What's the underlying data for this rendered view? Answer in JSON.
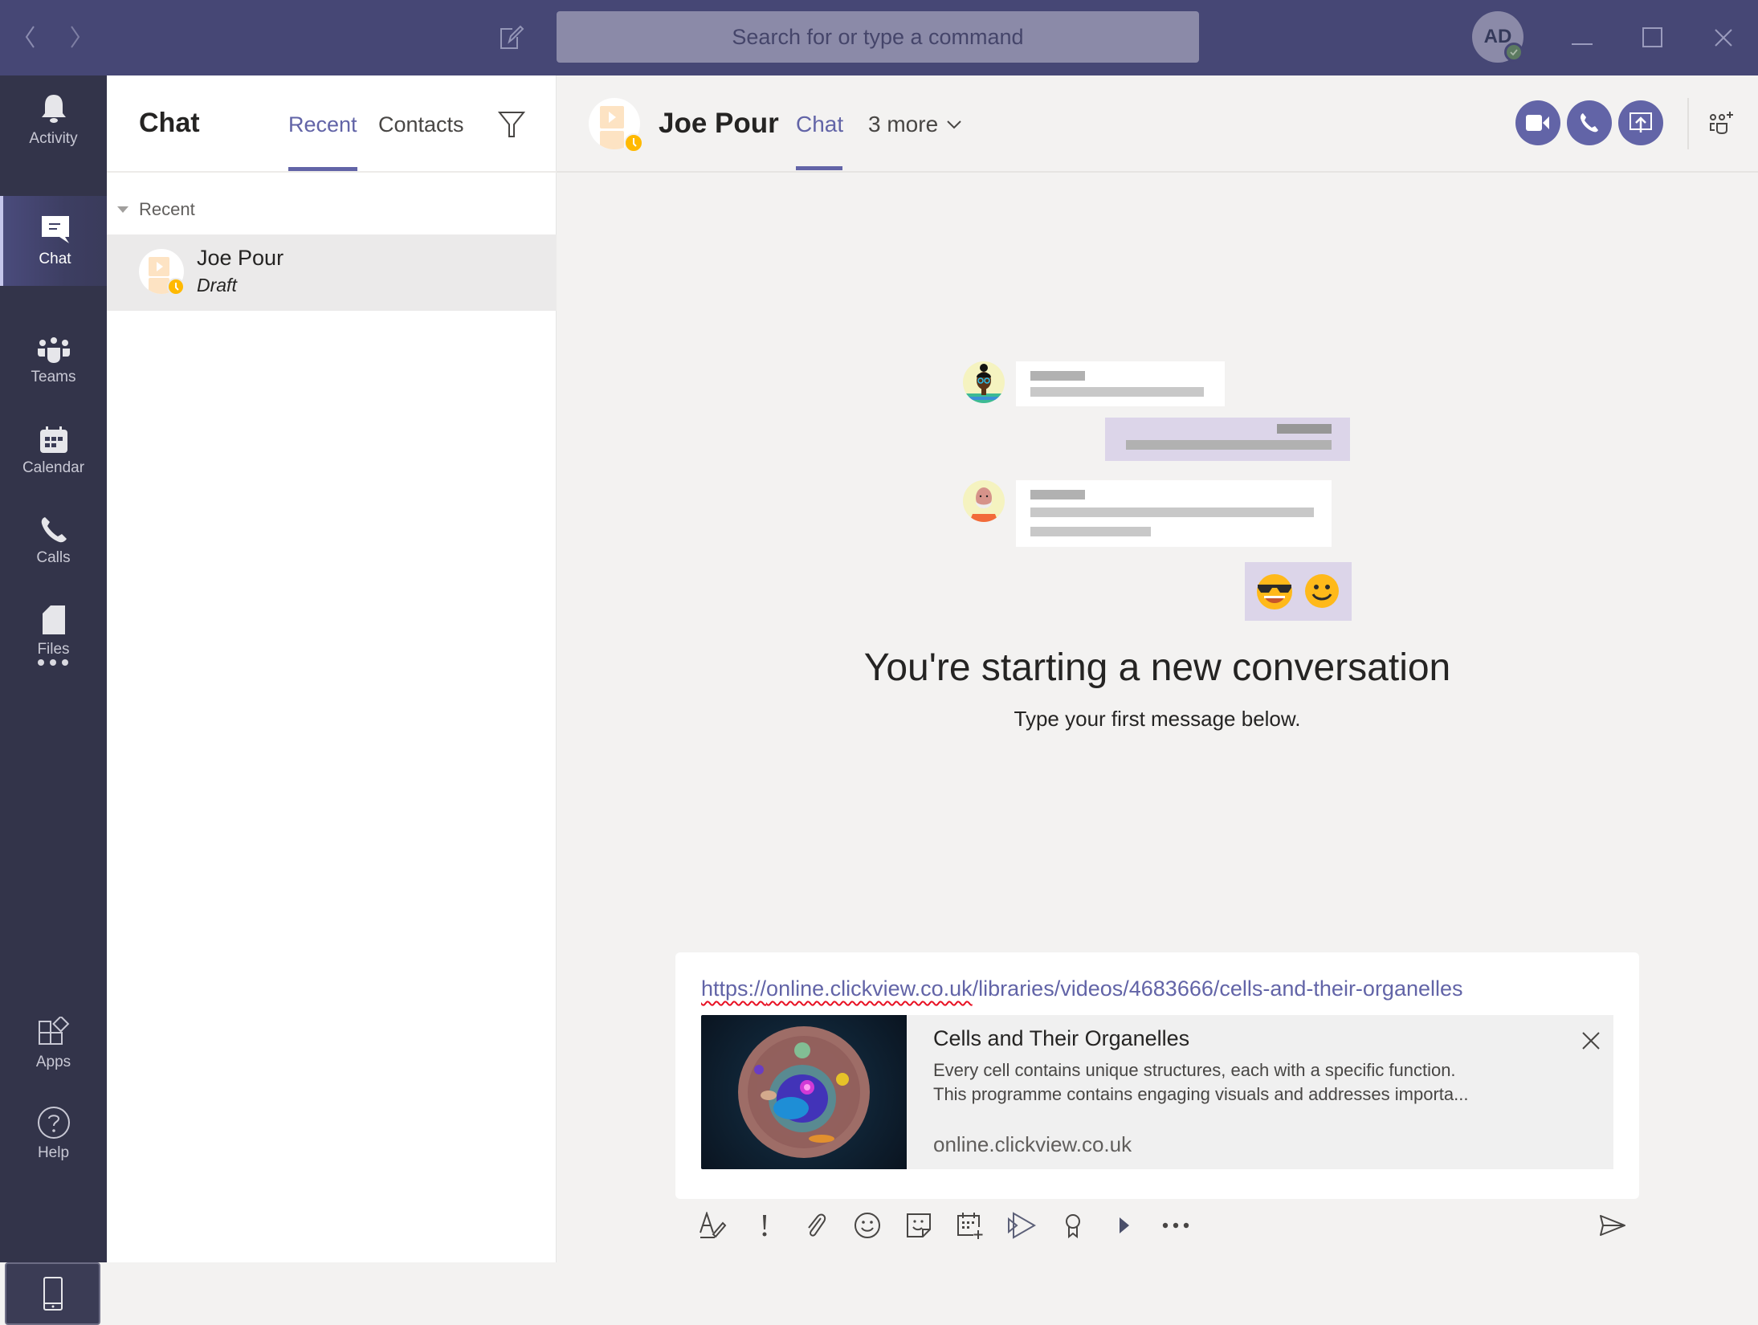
{
  "titlebar": {
    "search_placeholder": "Search for or type a command",
    "user_initials": "AD",
    "icons": {
      "back": "chevron-left-icon",
      "forward": "chevron-right-icon",
      "compose": "new-chat-icon",
      "minimize": "minimize-icon",
      "maximize": "maximize-icon",
      "close": "close-icon"
    }
  },
  "rail": {
    "items": [
      {
        "label": "Activity",
        "icon": "bell-icon"
      },
      {
        "label": "Chat",
        "icon": "chat-icon",
        "active": true
      },
      {
        "label": "Teams",
        "icon": "teams-icon"
      },
      {
        "label": "Calendar",
        "icon": "calendar-icon"
      },
      {
        "label": "Calls",
        "icon": "phone-icon"
      },
      {
        "label": "Files",
        "icon": "file-icon"
      }
    ],
    "more_icon": "more-icon",
    "bottom_items": [
      {
        "label": "Apps",
        "icon": "apps-icon"
      },
      {
        "label": "Help",
        "icon": "help-icon"
      }
    ],
    "device_icon": "mobile-icon"
  },
  "list_pane": {
    "title": "Chat",
    "tabs": [
      {
        "label": "Recent",
        "active": true
      },
      {
        "label": "Contacts",
        "active": false
      }
    ],
    "filter_icon": "filter-icon",
    "section_label": "Recent",
    "chats": [
      {
        "name": "Joe Pour",
        "subtitle": "Draft",
        "selected": true
      }
    ]
  },
  "conversation": {
    "contact_name": "Joe Pour",
    "tabs": [
      {
        "label": "Chat",
        "active": true
      }
    ],
    "more_tabs_label": "3 more",
    "actions": [
      "video-call-icon",
      "audio-call-icon",
      "share-screen-icon",
      "add-people-icon"
    ],
    "empty_state": {
      "title": "You're starting a new conversation",
      "subtitle": "Type your first message below."
    }
  },
  "compose": {
    "url_value": {
      "scheme": "https://",
      "host": "online.clickview.co.uk",
      "path": "/libraries/videos/4683666/cells-and-their-organelles"
    },
    "link_preview": {
      "title": "Cells and Their Organelles",
      "description_line1": "Every cell contains unique structures, each with a specific function.",
      "description_line2": "This programme contains engaging visuals and addresses importa...",
      "domain": "online.clickview.co.uk"
    },
    "toolbar": [
      "format-icon",
      "important-icon",
      "attach-icon",
      "emoji-icon",
      "sticker-icon",
      "schedule-meeting-icon",
      "stream-icon",
      "praise-icon",
      "video-icon",
      "more-options-icon"
    ],
    "send_icon": "send-icon"
  },
  "colors": {
    "brand": "#6264a7",
    "titlebar": "#464775",
    "rail": "#33344a",
    "draft_badge": "#ffb900"
  }
}
